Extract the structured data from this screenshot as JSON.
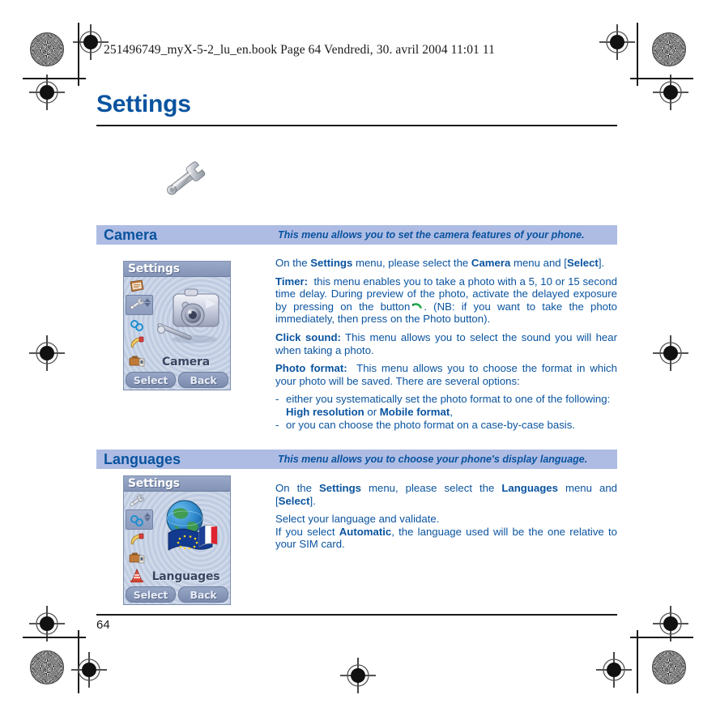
{
  "print": {
    "book_header": "251496749_myX-5-2_lu_en.book  Page 64  Vendredi, 30. avril 2004  11:01 11",
    "page_number": "64",
    "registration_mark_name": "registration-target"
  },
  "chapter": {
    "title": "Settings",
    "icon": "wrench-icon"
  },
  "colors": {
    "heading_blue": "#09539f",
    "section_bar_bg": "#aebce4",
    "body_blue": "#09539f",
    "call_icon_green": "#1faa4b",
    "rule_black": "#1a1a1a"
  },
  "sections": [
    {
      "name": "Camera",
      "description": "This menu allows you to set the camera features of your phone.",
      "screenshot": {
        "title": "Settings",
        "label": "Camera",
        "softkeys": [
          "Select",
          "Back"
        ],
        "hero_icon": "camera-icon",
        "menu_icons": [
          "phonebook-icon",
          "settings-wrench-icon",
          "network-icon",
          "tones-icon",
          "toolbox-icon",
          "games-icon"
        ],
        "selected_index": 1
      },
      "paragraphs": [
        {
          "type": "rich",
          "parts": [
            {
              "t": "On the "
            },
            {
              "t": "Settings",
              "b": true
            },
            {
              "t": " menu, please select the "
            },
            {
              "t": "Camera",
              "b": true
            },
            {
              "t": " menu and ["
            },
            {
              "t": "Select",
              "b": true
            },
            {
              "t": "]."
            }
          ]
        },
        {
          "type": "rich",
          "parts": [
            {
              "t": "Timer:",
              "b": true
            },
            {
              "t": "  this menu enables you to take a photo with a 5, 10 or 15 second time delay. During preview of the photo, activate the delayed exposure by pressing on the button "
            },
            {
              "icon": "call-icon"
            },
            {
              "t": ". (NB: if you want to take the photo immediately, then press on the Photo button)."
            }
          ]
        },
        {
          "type": "rich",
          "parts": [
            {
              "t": "Click sound:",
              "b": true
            },
            {
              "t": " This menu allows you to select the sound you will hear when taking a photo."
            }
          ]
        },
        {
          "type": "rich",
          "parts": [
            {
              "t": "Photo format:",
              "b": true
            },
            {
              "t": "  This menu allows you to choose the format in which your photo will be saved. There are several options:"
            }
          ]
        }
      ],
      "bullets": [
        {
          "dash": "-",
          "parts": [
            {
              "t": "either you systematically set the photo format to one of the following: "
            },
            {
              "t": "High resolution",
              "b": true
            },
            {
              "t": " or "
            },
            {
              "t": "Mobile format",
              "b": true
            },
            {
              "t": ","
            }
          ]
        },
        {
          "dash": "-",
          "parts": [
            {
              "t": "or you can choose the photo format on a case-by-case basis."
            }
          ]
        }
      ]
    },
    {
      "name": "Languages",
      "description": "This menu allows you to choose your phone's display language.",
      "screenshot": {
        "title": "Settings",
        "label": "Languages",
        "softkeys": [
          "Select",
          "Back"
        ],
        "hero_icon": "globe-flags-icon",
        "menu_icons": [
          "settings-wrench-icon",
          "network-icon",
          "tones-icon",
          "toolbox-icon",
          "games-icon",
          "wap-icon"
        ],
        "selected_index": 1
      },
      "paragraphs": [
        {
          "type": "rich",
          "parts": [
            {
              "t": "On the "
            },
            {
              "t": "Settings",
              "b": true
            },
            {
              "t": " menu, please select the "
            },
            {
              "t": "Languages",
              "b": true
            },
            {
              "t": " menu and ["
            },
            {
              "t": "Select",
              "b": true
            },
            {
              "t": "]."
            }
          ]
        },
        {
          "type": "rich",
          "noj": true,
          "parts": [
            {
              "t": "Select your language and validate."
            }
          ]
        },
        {
          "type": "rich",
          "parts": [
            {
              "t": "If you select "
            },
            {
              "t": "Automatic",
              "b": true
            },
            {
              "t": ", the language used will be the one relative to your SIM card."
            }
          ]
        }
      ],
      "bullets": []
    }
  ]
}
